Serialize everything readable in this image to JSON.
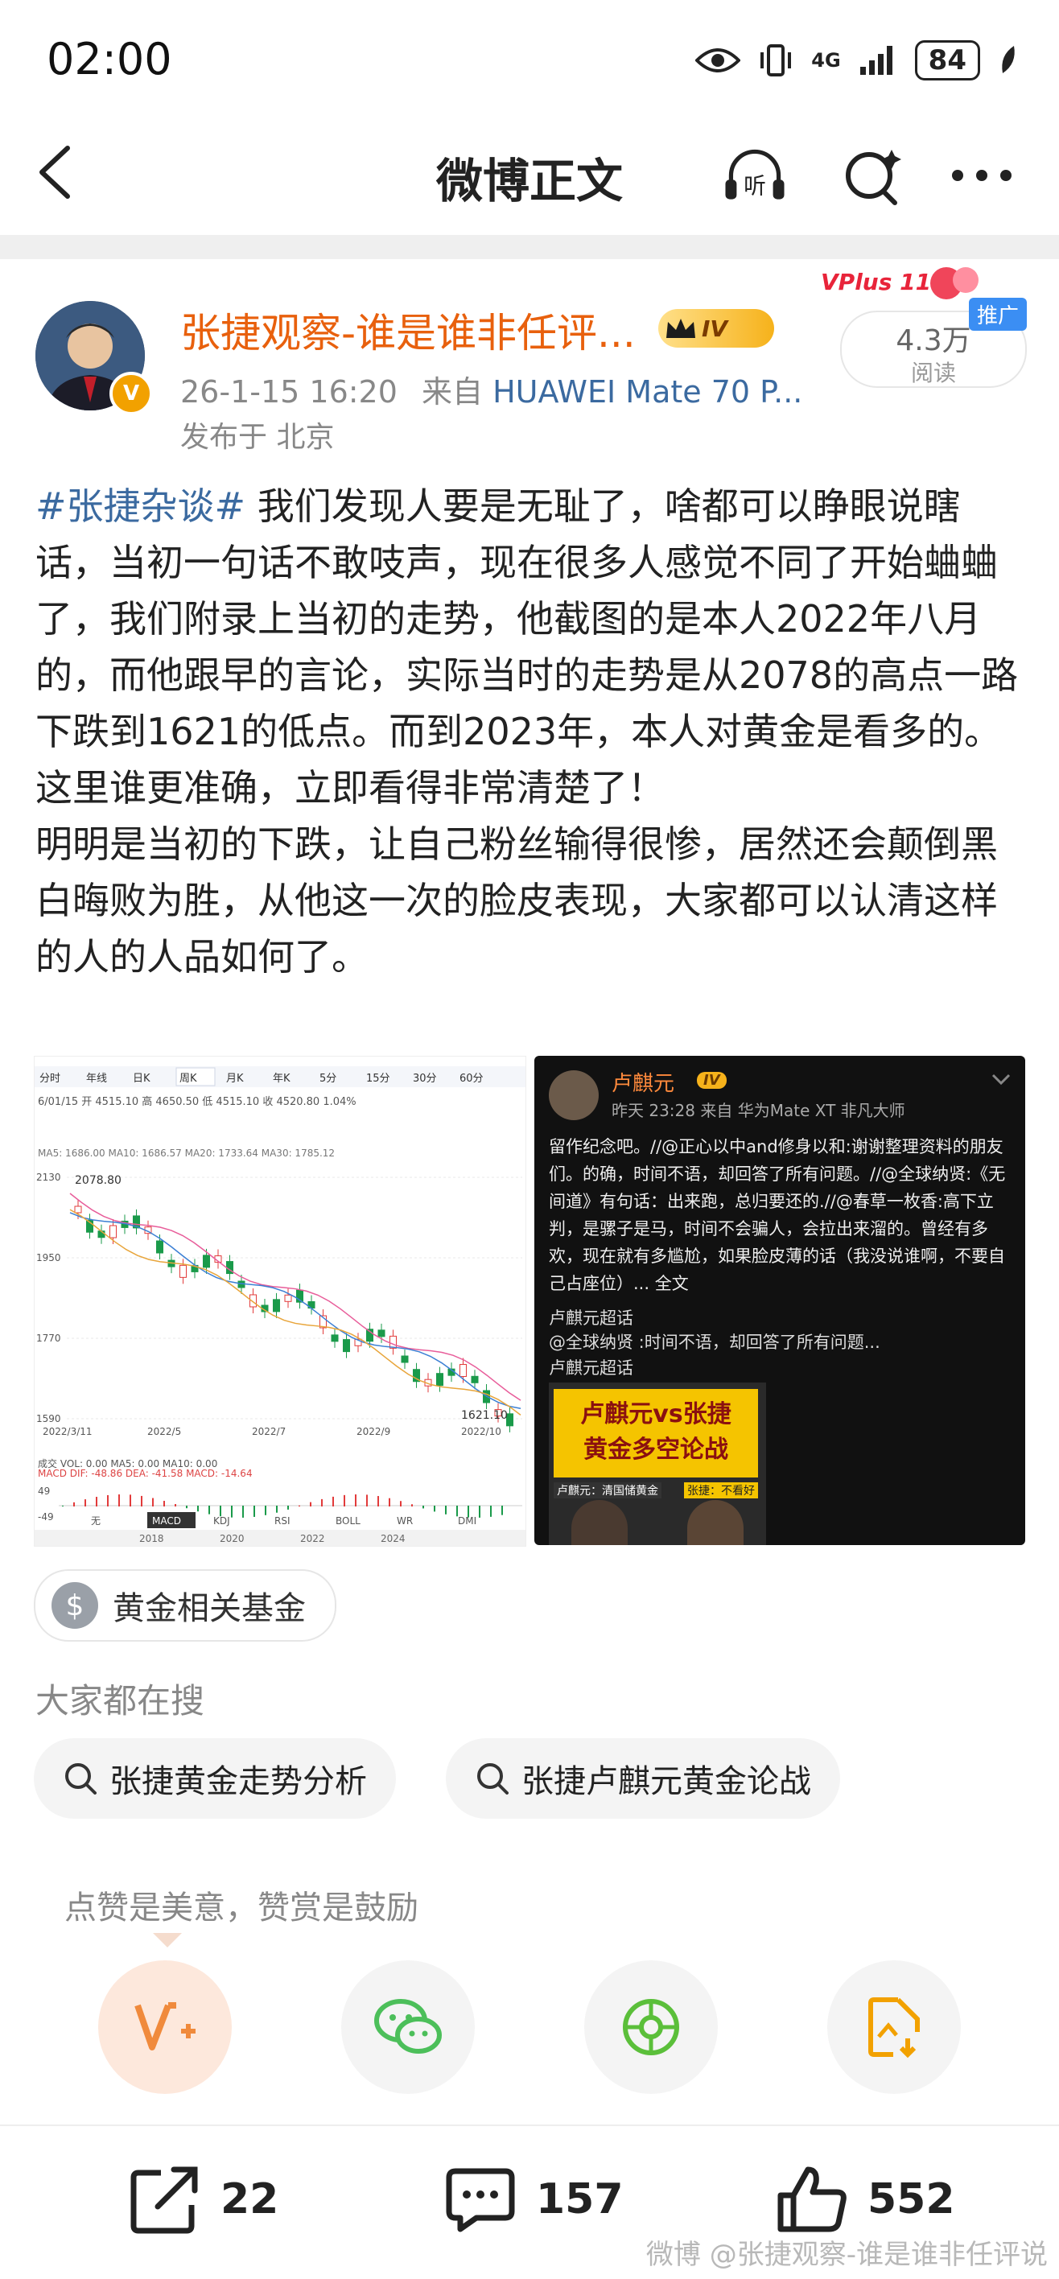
{
  "status_bar": {
    "time": "02:00",
    "network": "4G",
    "battery": "84"
  },
  "nav": {
    "title": "微博正文",
    "listen_label": "听"
  },
  "author": {
    "name": "张捷观察-谁是谁非任评...",
    "level": "IV",
    "verified_mark": "V",
    "time": "26-1-15 16:20",
    "source_prefix": "来自",
    "device": "HUAWEI Mate 70 P...",
    "location": "发布于 北京"
  },
  "promo": {
    "vplus": "VPlus 11.11",
    "reads": "4.3万",
    "reads_label": "阅读",
    "badge": "推广"
  },
  "post": {
    "hashtag": "#张捷杂谈#",
    "body": " 我们发现人要是无耻了，啥都可以睁眼说瞎话，当初一句话不敢吱声，现在很多人感觉不同了开始蛐蛐了，我们附录上当初的走势，他截图的是本人2022年八月的，而他跟早的言论，实际当时的走势是从2078的高点一路下跌到1621的低点。而到2023年，本人对黄金是看多的。这里谁更准确，立即看得非常清楚了！\n明明是当初的下跌，让自己粉丝输得很惨，居然还会颠倒黑白晦败为胜，从他这一次的脸皮表现，大家都可以认清这样的人的人品如何了。"
  },
  "chart_image": {
    "tabs": [
      "分时",
      "年线",
      "日K",
      "周K",
      "月K",
      "年K",
      "5分",
      "15分",
      "30分",
      "60分"
    ],
    "ma_line": "MA5: 1686.00  MA10: 1686.57  MA20: 1733.64  MA30: 1785.12",
    "price_line": "6/01/15 开 4515.10  高 4650.50  低 4515.10  收 4520.80  1.04%",
    "high": "2078.80",
    "low": "1621.10",
    "y_ticks": [
      "2130",
      "1950",
      "1770",
      "1590"
    ],
    "x_ticks": [
      "2022/3/11",
      "2022/5",
      "2022/7",
      "2022/9",
      "2022/10"
    ],
    "vol_line": "成交 VOL: 0.00   MA5: 0.00   MA10: 0.00",
    "macd_line": "MACD  DIF: -48.86   DEA: -41.58   MACD: -14.64",
    "macd_ticks": [
      "49",
      "-49"
    ],
    "indicator_tabs": [
      "无",
      "MACD",
      "KDJ",
      "RSI",
      "BOLL",
      "WR",
      "DMI"
    ],
    "year_ticks": [
      "2018",
      "2020",
      "2022",
      "2024"
    ],
    "colors": {
      "up": "#e23b3b",
      "down": "#1a9a4a",
      "ma5": "#e85d9a",
      "ma10": "#3b7fd4",
      "ma20": "#e8a53b"
    }
  },
  "repost_image": {
    "name": "卢麒元",
    "level": "IV",
    "time": "昨天 23:28",
    "source": "来自 华为Mate XT 非凡大师",
    "text": "留作纪念吧。//@正心以中and修身以和:谢谢整理资料的朋友们。的确，时间不语，却回答了所有问题。//@全球纳贤:《无间道》有句话：出来跑，总归要还的.//@春草一枚香:高下立判，是骡子是马，时间不会骗人，会拉出来溜的。曾经有多欢，现在就有多尴尬，如果脸皮薄的话（我没说谁啊，不要自己占座位）... 全文",
    "super_topic": "卢麒元超话",
    "quote": "@全球纳贤 :时间不语，却回答了所有问题...",
    "quote_topic": "卢麒元超话",
    "thumb_title_1": "卢麒元vs张捷",
    "thumb_title_2": "黄金多空论战",
    "thumb_caption": "卢麒元：清国储黄金",
    "thumb_caption_2": "张捷：不看好"
  },
  "fund_chip": {
    "icon": "$",
    "label": "黄金相关基金"
  },
  "search": {
    "heading": "大家都在搜",
    "items": [
      "张捷黄金走势分析",
      "张捷卢麒元黄金论战"
    ]
  },
  "reward": {
    "text": "点赞是美意，赞赏是鼓励",
    "vip_colors": [
      "#fde8dc",
      "#f08a3c"
    ],
    "wechat_color": "#4cbf5a",
    "moments_color": "#5bbf3a",
    "save_color": "#f2a100"
  },
  "actions": {
    "share": "22",
    "comments": "157",
    "likes": "552"
  },
  "watermark": "微博 @张捷观察-谁是谁非任评说"
}
